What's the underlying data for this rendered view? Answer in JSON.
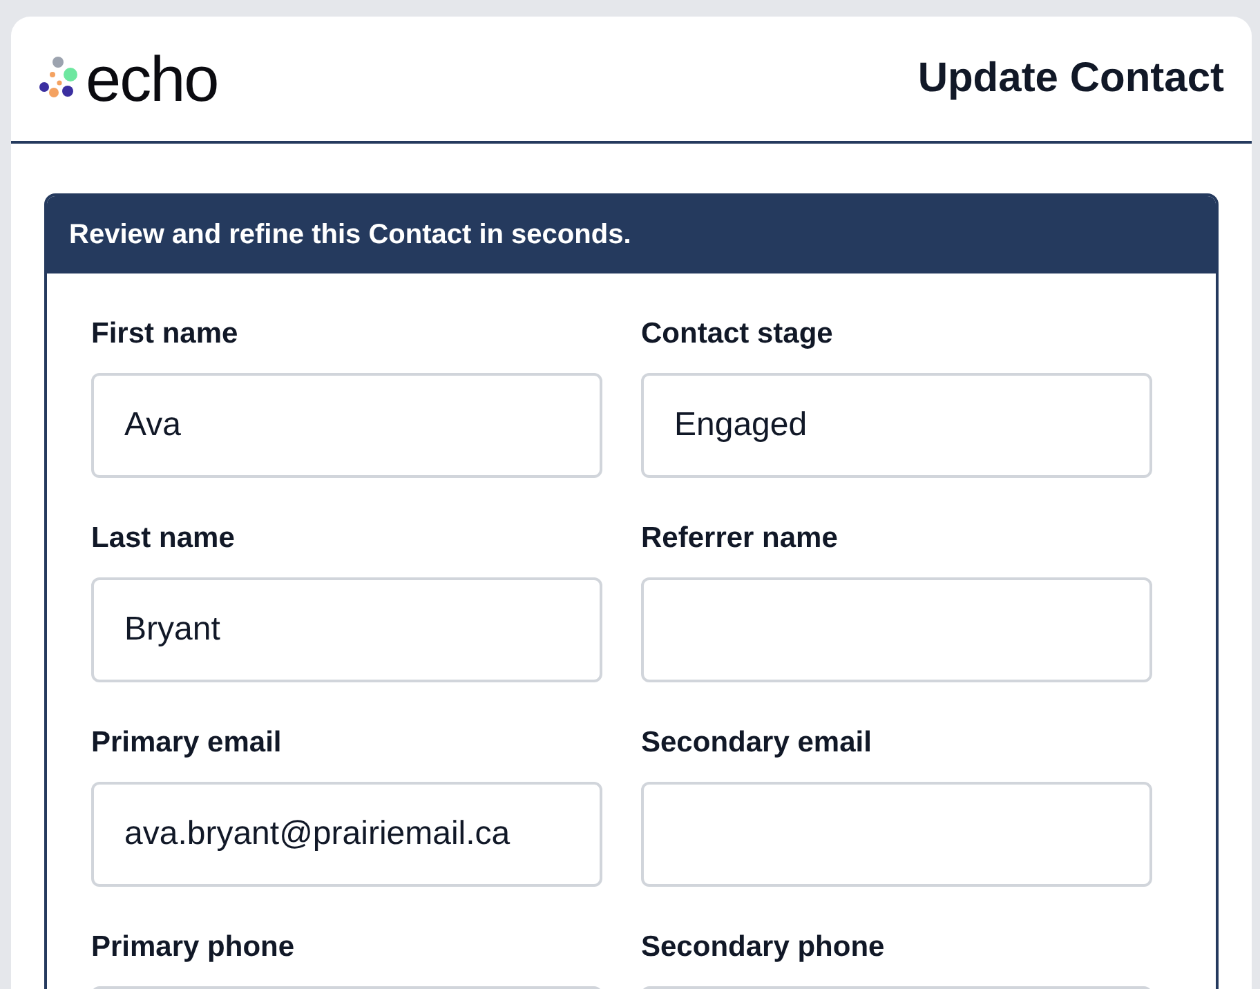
{
  "header": {
    "logo": "echo",
    "title": "Update Contact"
  },
  "panel": {
    "heading": "Review and refine this Contact in seconds.",
    "fields": [
      {
        "label": "First name",
        "value": "Ava"
      },
      {
        "label": "Contact stage",
        "value": "Engaged"
      },
      {
        "label": "Last name",
        "value": "Bryant"
      },
      {
        "label": "Referrer name"
      },
      {
        "label": "Primary email",
        "value": "ava.bryant@prairiemail.ca"
      },
      {
        "label": "Secondary email"
      },
      {
        "label": "Primary phone"
      },
      {
        "label": "Secondary phone"
      }
    ]
  }
}
